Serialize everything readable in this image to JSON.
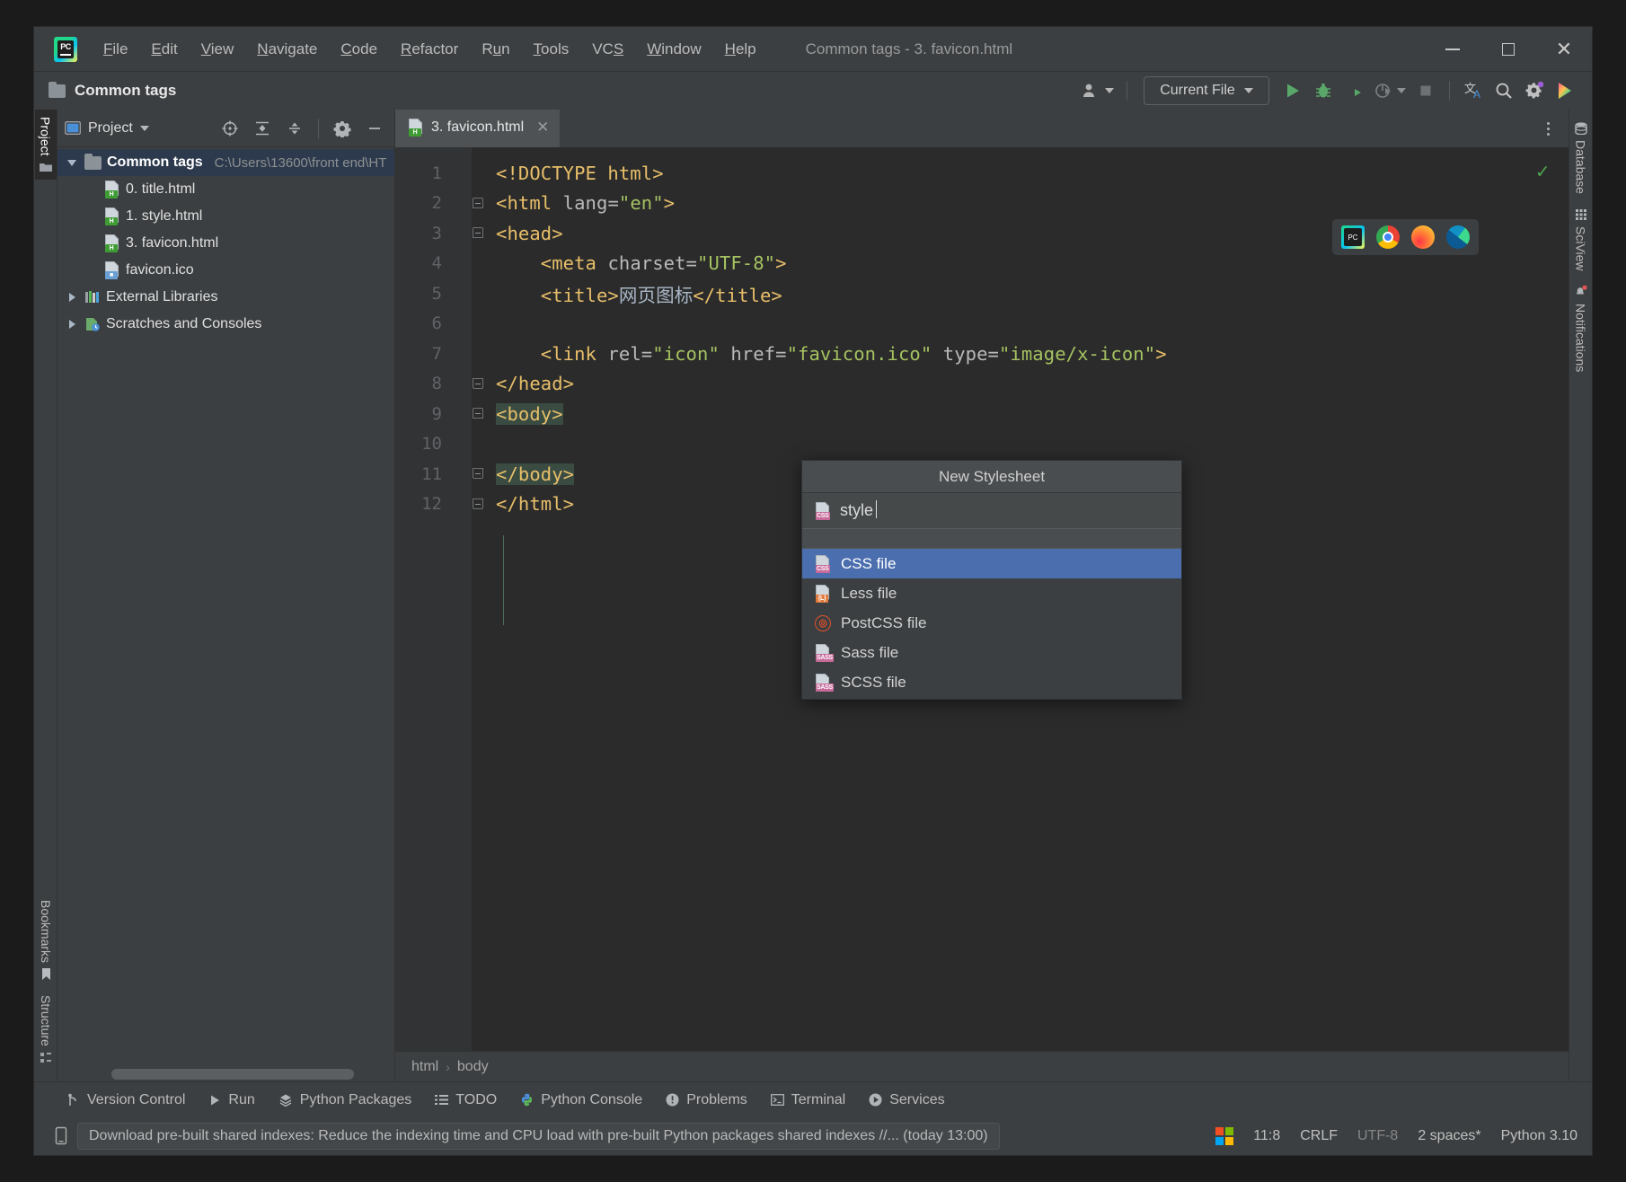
{
  "window": {
    "title": "Common tags - 3. favicon.html",
    "app_icon": "pycharm-logo",
    "minimize": "minimize-icon",
    "maximize": "maximize-icon",
    "close": "close-icon"
  },
  "menubar": {
    "items": [
      {
        "label": "File",
        "mnemonic": "F"
      },
      {
        "label": "Edit",
        "mnemonic": "E"
      },
      {
        "label": "View",
        "mnemonic": "V"
      },
      {
        "label": "Navigate",
        "mnemonic": "N"
      },
      {
        "label": "Code",
        "mnemonic": "C"
      },
      {
        "label": "Refactor",
        "mnemonic": "R"
      },
      {
        "label": "Run",
        "mnemonic": "u"
      },
      {
        "label": "Tools",
        "mnemonic": "T"
      },
      {
        "label": "VCS",
        "mnemonic": "S"
      },
      {
        "label": "Window",
        "mnemonic": "W"
      },
      {
        "label": "Help",
        "mnemonic": "H"
      }
    ]
  },
  "toolbar": {
    "project_name": "Common tags",
    "run_config": "Current File",
    "buttons": [
      {
        "name": "user-account-icon"
      },
      {
        "name": "run-icon"
      },
      {
        "name": "debug-icon"
      },
      {
        "name": "run-coverage-icon"
      },
      {
        "name": "profiler-icon"
      },
      {
        "name": "stop-icon"
      },
      {
        "name": "translate-icon"
      },
      {
        "name": "search-everywhere-icon"
      },
      {
        "name": "settings-icon"
      },
      {
        "name": "ide-assistant-icon"
      }
    ]
  },
  "left_strip": {
    "tabs": [
      {
        "label": "Project",
        "icon": "project-folder-icon",
        "active": true
      },
      {
        "label": "Bookmarks",
        "icon": "bookmark-icon",
        "active": false
      },
      {
        "label": "Structure",
        "icon": "structure-icon",
        "active": false
      }
    ]
  },
  "right_strip": {
    "tabs": [
      {
        "label": "Database",
        "icon": "database-icon"
      },
      {
        "label": "SciView",
        "icon": "sciview-icon"
      },
      {
        "label": "Notifications",
        "icon": "notifications-bell-icon"
      }
    ]
  },
  "project_panel": {
    "title": "Project",
    "header_icons": [
      {
        "name": "select-opened-file-icon"
      },
      {
        "name": "expand-all-icon"
      },
      {
        "name": "collapse-all-icon"
      },
      {
        "name": "settings-gear-icon"
      },
      {
        "name": "hide-panel-icon"
      }
    ],
    "tree": [
      {
        "label": "Common tags",
        "path": "C:\\Users\\13600\\front end\\HT",
        "icon": "folder-icon",
        "expanded": true,
        "selected": true,
        "depth": 0,
        "bold": true
      },
      {
        "label": "0. title.html",
        "icon": "html-file-icon",
        "depth": 1
      },
      {
        "label": "1. style.html",
        "icon": "html-file-icon",
        "depth": 1
      },
      {
        "label": "3. favicon.html",
        "icon": "html-file-icon",
        "depth": 1
      },
      {
        "label": "favicon.ico",
        "icon": "image-file-icon",
        "depth": 1
      },
      {
        "label": "External Libraries",
        "icon": "libraries-icon",
        "expanded": false,
        "depth": 0
      },
      {
        "label": "Scratches and Consoles",
        "icon": "scratches-icon",
        "expanded": false,
        "depth": 0
      }
    ]
  },
  "editor": {
    "tabs": [
      {
        "label": "3. favicon.html",
        "icon": "html-file-icon",
        "active": true,
        "close": "close-tab-icon"
      }
    ],
    "inspection_status": "inspection-ok-checkmark",
    "browsers": [
      {
        "name": "open-in-pycharm-browser-icon"
      },
      {
        "name": "open-in-chrome-icon"
      },
      {
        "name": "open-in-firefox-icon"
      },
      {
        "name": "open-in-edge-icon"
      }
    ],
    "lines": [
      {
        "num": "1",
        "text": "<!DOCTYPE html>"
      },
      {
        "num": "2",
        "text": "<html lang=\"en\">"
      },
      {
        "num": "3",
        "text": "<head>"
      },
      {
        "num": "4",
        "text": "    <meta charset=\"UTF-8\">"
      },
      {
        "num": "5",
        "text": "    <title>网页图标</title>"
      },
      {
        "num": "6",
        "text": ""
      },
      {
        "num": "7",
        "text": "    <link rel=\"icon\" href=\"favicon.ico\" type=\"image/x-icon\">"
      },
      {
        "num": "8",
        "text": "</head>"
      },
      {
        "num": "9",
        "text": "<body>"
      },
      {
        "num": "10",
        "text": ""
      },
      {
        "num": "11",
        "text": "</body>"
      },
      {
        "num": "12",
        "text": "</html>"
      }
    ]
  },
  "popup": {
    "title": "New Stylesheet",
    "input_value": "style",
    "input_icon": "css-file-icon",
    "options": [
      {
        "label": "CSS file",
        "icon": "css-file-icon",
        "selected": true
      },
      {
        "label": "Less file",
        "icon": "less-file-icon",
        "selected": false
      },
      {
        "label": "PostCSS file",
        "icon": "postcss-file-icon",
        "selected": false
      },
      {
        "label": "Sass file",
        "icon": "sass-file-icon",
        "selected": false
      },
      {
        "label": "SCSS file",
        "icon": "scss-file-icon",
        "selected": false
      }
    ]
  },
  "breadcrumb": {
    "items": [
      "html",
      "body"
    ],
    "separator": "›"
  },
  "tool_windows": [
    {
      "label": "Version Control",
      "icon": "version-control-icon"
    },
    {
      "label": "Run",
      "icon": "run-triangle-icon"
    },
    {
      "label": "Python Packages",
      "icon": "python-packages-icon"
    },
    {
      "label": "TODO",
      "icon": "todo-list-icon"
    },
    {
      "label": "Python Console",
      "icon": "python-console-icon"
    },
    {
      "label": "Problems",
      "icon": "problems-icon"
    },
    {
      "label": "Terminal",
      "icon": "terminal-icon"
    },
    {
      "label": "Services",
      "icon": "services-icon"
    }
  ],
  "statusbar": {
    "notification_icon": "ide-notification-icon",
    "message": "Download pre-built shared indexes: Reduce the indexing time and CPU load with pre-built Python packages shared indexes //... (today 13:00)",
    "windows_icon": "windows-logo-icon",
    "caret_position": "11:8",
    "line_separator": "CRLF",
    "encoding": "UTF-8",
    "indent": "2 spaces*",
    "interpreter": "Python 3.10"
  },
  "colors": {
    "accent_selection": "#4b6eaf",
    "tree_selection": "#2d3a4d",
    "editor_bg": "#2b2b2b",
    "panel_bg": "#3c3f41",
    "tag_color": "#e8bf6a",
    "string_color": "#a5c261",
    "attr_color": "#bababa",
    "body_highlight": "#3a4c42",
    "green_run": "#59a869"
  }
}
